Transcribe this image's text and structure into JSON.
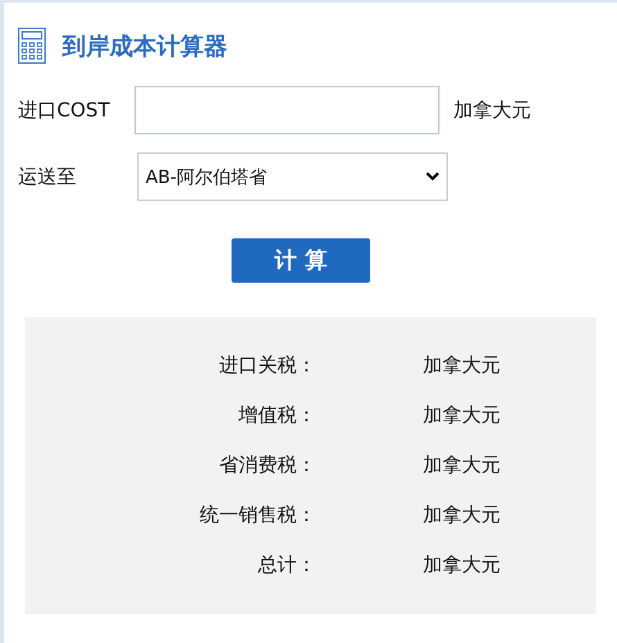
{
  "title": "到岸成本计算器",
  "cost": {
    "label": "进口COST",
    "unit": "加拿大元"
  },
  "destination": {
    "label": "运送至",
    "value": "AB-阿尔伯塔省"
  },
  "button": "计 算",
  "results": [
    {
      "label": "进口关税：",
      "unit": "加拿大元"
    },
    {
      "label": "增值税：",
      "unit": "加拿大元"
    },
    {
      "label": "省消费税：",
      "unit": "加拿大元"
    },
    {
      "label": "统一销售税：",
      "unit": "加拿大元"
    },
    {
      "label": "总计：",
      "unit": "加拿大元"
    }
  ]
}
